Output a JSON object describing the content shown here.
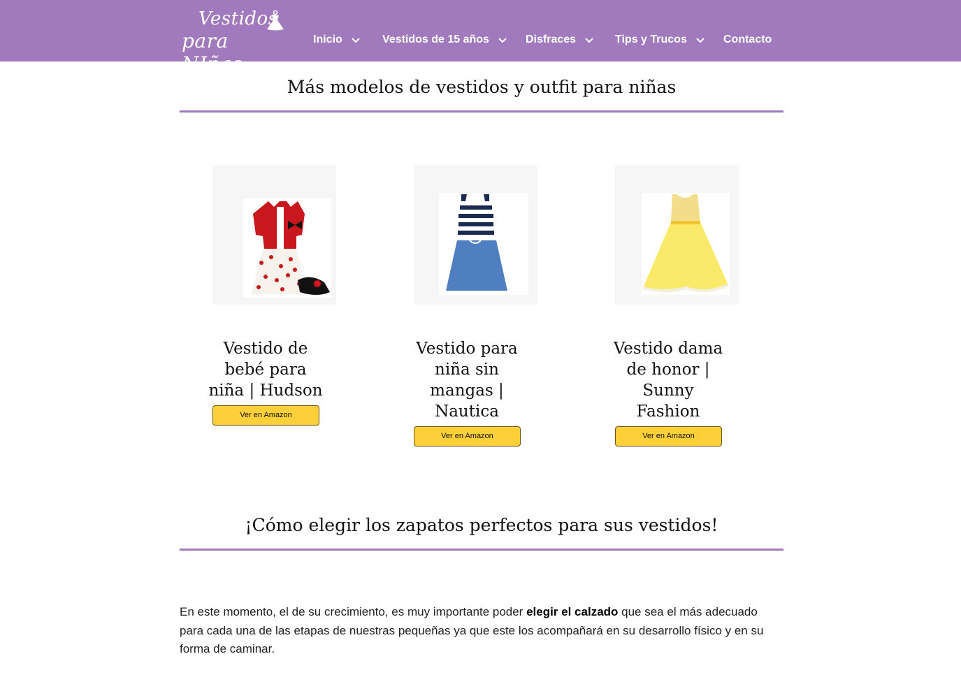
{
  "header": {
    "logo_line1": "Vestidos",
    "logo_line2": "para NIñas",
    "background_color": "#a07abd",
    "nav": [
      {
        "label": "Inicio",
        "has_dropdown": true
      },
      {
        "label": "Vestidos de 15 años",
        "has_dropdown": true
      },
      {
        "label": "Disfraces",
        "has_dropdown": true
      },
      {
        "label": "Tips y Trucos",
        "has_dropdown": true
      },
      {
        "label": "Contacto",
        "has_dropdown": false
      }
    ]
  },
  "section1": {
    "title": "Más modelos de vestidos y outfit para niñas"
  },
  "products": [
    {
      "title": "Vestido de bebé para niña | Hudson",
      "button": "Ver en Amazon",
      "image": "red-cardigan-cherry-dress"
    },
    {
      "title": "Vestido para niña sin mangas | Nautica",
      "button": "Ver en Amazon",
      "image": "navy-stripe-denim-dress"
    },
    {
      "title": "Vestido dama de honor | Sunny Fashion",
      "button": "Ver en Amazon",
      "image": "yellow-tulle-dress"
    }
  ],
  "section2": {
    "title": "¡Cómo elegir los zapatos perfectos para sus vestidos!",
    "paragraph_before": "En este momento, el de su crecimiento, es muy importante poder ",
    "paragraph_bold": "elegir el calzado",
    "paragraph_after": " que sea el más adecuado para cada una de las etapas de nuestras pequeñas ya que este los acompañará en su desarrollo físico y en su forma de caminar."
  },
  "colors": {
    "accent": "#a07abd",
    "button": "#fdd03a"
  }
}
